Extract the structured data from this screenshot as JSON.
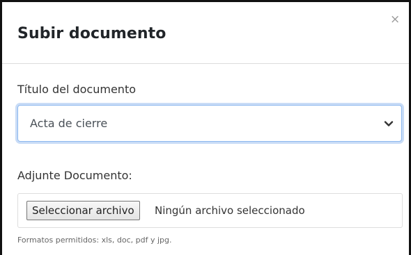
{
  "modal": {
    "title": "Subir documento",
    "close_glyph": "×"
  },
  "form": {
    "document_title": {
      "label": "Título del documento",
      "selected_value": "Acta de cierre"
    },
    "attachment": {
      "label": "Adjunte Documento:",
      "button_label": "Seleccionar archivo",
      "status": "Ningún archivo seleccionado",
      "hint": "Formatos permitidos: xls, doc, pdf y jpg."
    }
  },
  "icons": {
    "close": "close-icon",
    "dropdown": "chevron-down-icon"
  },
  "colors": {
    "focus_ring": "#8cb8ef",
    "frame_border": "#111111",
    "title_text": "#212529"
  }
}
